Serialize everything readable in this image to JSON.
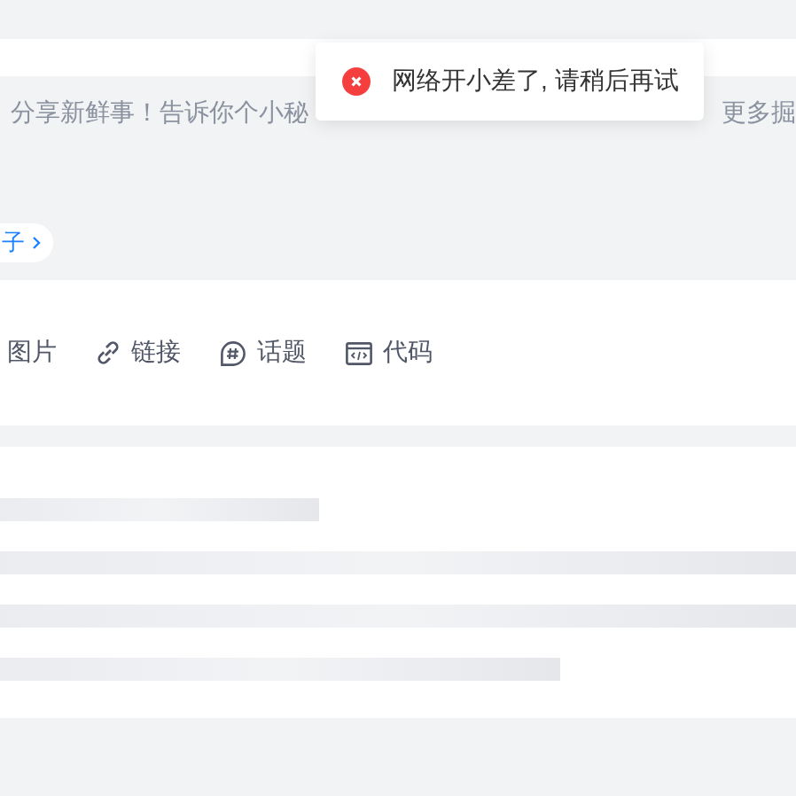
{
  "editor": {
    "placeholder_start": "分享新鲜事！告诉你个小秘",
    "placeholder_end": "更多掘",
    "topic_chip": "子"
  },
  "toast": {
    "kind": "error",
    "message": "网络开小差了, 请稍后再试"
  },
  "toolbar": [
    {
      "kind": "image",
      "label": "图片"
    },
    {
      "kind": "link",
      "label": "链接"
    },
    {
      "kind": "topic",
      "label": "话题"
    },
    {
      "kind": "code",
      "label": "代码"
    }
  ]
}
